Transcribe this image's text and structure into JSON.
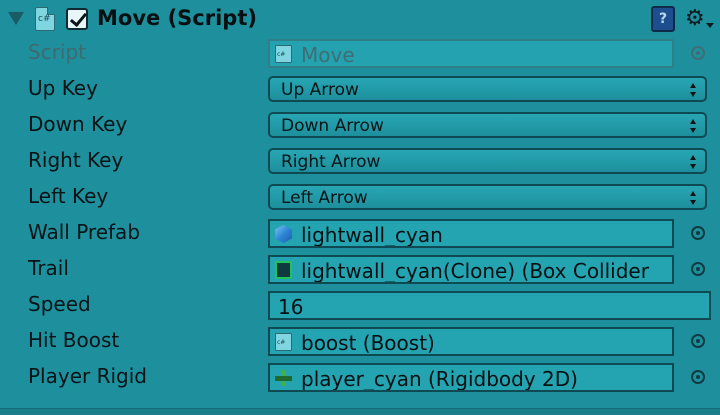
{
  "component": {
    "title": "Move (Script)",
    "enabled": true,
    "icons": [
      "foldout-arrow-icon",
      "csharp-script-icon",
      "checkbox-icon",
      "help-book-icon",
      "gear-icon"
    ]
  },
  "fields": [
    {
      "label": "Script",
      "type": "object",
      "value": "Move",
      "icon": "script-icon",
      "disabled": true
    },
    {
      "label": "Up Key",
      "type": "enum",
      "value": "Up Arrow"
    },
    {
      "label": "Down Key",
      "type": "enum",
      "value": "Down Arrow"
    },
    {
      "label": "Right Key",
      "type": "enum",
      "value": "Right Arrow"
    },
    {
      "label": "Left Key",
      "type": "enum",
      "value": "Left Arrow"
    },
    {
      "label": "Wall Prefab",
      "type": "object",
      "value": "lightwall_cyan",
      "icon": "prefab-cube-icon"
    },
    {
      "label": "Trail",
      "type": "object",
      "value": "lightwall_cyan(Clone) (Box Collider",
      "icon": "box-collider-icon"
    },
    {
      "label": "Speed",
      "type": "number",
      "value": "16"
    },
    {
      "label": "Hit Boost",
      "type": "object",
      "value": "boost (Boost)",
      "icon": "script-icon"
    },
    {
      "label": "Player Rigid",
      "type": "object",
      "value": "player_cyan (Rigidbody 2D)",
      "icon": "rigidbody2d-icon"
    }
  ],
  "colors": {
    "background": "#1e8f9d",
    "field": "#24a3b1",
    "text": "#0a1315"
  }
}
